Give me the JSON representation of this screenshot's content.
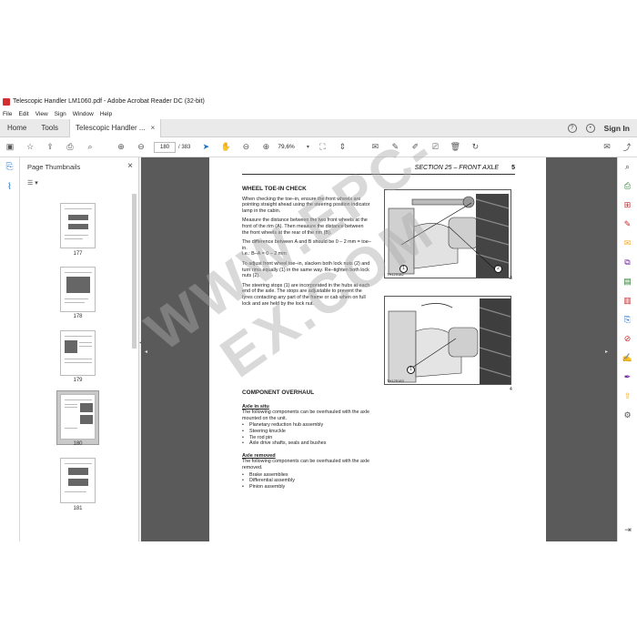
{
  "window": {
    "title": "Telescopic Handler LM1060.pdf - Adobe Acrobat Reader DC (32-bit)"
  },
  "menu": [
    "File",
    "Edit",
    "View",
    "Sign",
    "Window",
    "Help"
  ],
  "tabs": {
    "home": "Home",
    "tools": "Tools",
    "document": "Telescopic Handler ...",
    "close": "×",
    "sign_in": "Sign In"
  },
  "toolbar": {
    "current_page": "180",
    "total_pages": "/ 383",
    "zoom": "79,6%"
  },
  "thumbnails": {
    "title": "Page Thumbnails",
    "close": "×",
    "options": "☰ ▾",
    "pages": [
      "177",
      "178",
      "179",
      "180",
      "181"
    ],
    "selected": "180"
  },
  "page": {
    "section_title": "SECTION 25 – FRONT AXLE",
    "section_number": "5",
    "heading_toe": "WHEEL TOE-IN CHECK",
    "para1": "When checking the toe–in, ensure the front wheels are pointing straight ahead using the steering position indicator lamp in the cabin.",
    "para2": "Measure the distance between the two front wheels at the front of the rim (A). Then measure the distance between the front wheels at the rear of the rim (B).",
    "para3": "The difference between A and B should be 0 – 2 mm = toe–in.",
    "para3b": "i.e.: B–A = 0 – 2 mm",
    "para4": "To adjust front wheel toe–in, slacken both lock nuts (2) and turn rims equally (1) in the same way. Re–tighten both lock nuts (2).",
    "para5": "The steering stops (1) are incorporated in the hubs at each end of the axle. The stops are adjustable to prevent the tyres contacting any part of the frame or cab when on full lock and are held by the lock nut.",
    "heading_overhaul": "COMPONENT OVERHAUL",
    "axle_in_situ": "Axle in situ",
    "in_situ_intro": "The following components can be overhauled with the axle mounted on the unit.",
    "in_situ_items": [
      "Planetary reduction hub assembly",
      "Steering knuckle",
      "Tie rod pin",
      "Axle drive shafts, seals and bushes"
    ],
    "axle_removed": "Axle removed",
    "removed_intro": "The following components can be overhauled with the axle removed.",
    "removed_items": [
      "Brake assemblies",
      "Differential assembly",
      "Pinion assembly"
    ],
    "fig1_code": "TH125182",
    "fig1_num": "3",
    "fig2_code": "TH125183",
    "fig2_num": "4",
    "callout_1": "1",
    "callout_2": "2"
  },
  "watermark": "WWW.EPC-EX.COM"
}
